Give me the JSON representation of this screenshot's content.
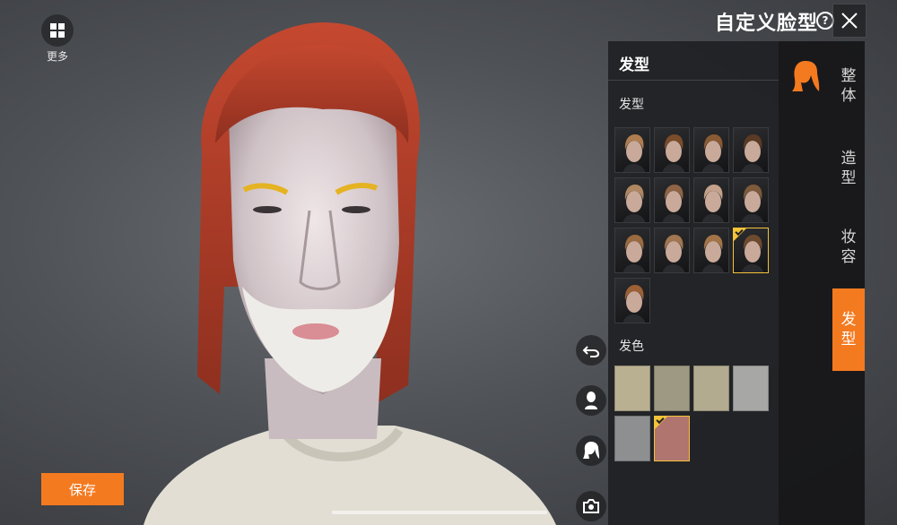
{
  "header": {
    "title": "自定义脸型",
    "help_glyph": "?"
  },
  "more_button": {
    "label": "更多",
    "icon": "grid-icon"
  },
  "panel": {
    "title": "发型",
    "hairstyle_section_label": "发型",
    "haircolor_section_label": "发色",
    "hairstyles": [
      {
        "tone": "#b07d4f"
      },
      {
        "tone": "#7a4c2a"
      },
      {
        "tone": "#8a5a33"
      },
      {
        "tone": "#5a3a25"
      },
      {
        "tone": "#b08760"
      },
      {
        "tone": "#8f6444"
      },
      {
        "tone": "#c3a18a"
      },
      {
        "tone": "#7d5a3c"
      },
      {
        "tone": "#9a6a40"
      },
      {
        "tone": "#a17650"
      },
      {
        "tone": "#a37448"
      },
      {
        "tone": "#6e4a2e"
      },
      {
        "tone": "#9b6034"
      }
    ],
    "selected_hairstyle_index": 11,
    "hair_colors": [
      "#b9b092",
      "#9d9982",
      "#b2ab8f",
      "#a7a7a5",
      "#8e8f91",
      "#b1756f"
    ],
    "selected_color_index": 5
  },
  "category_icon": {
    "name": "hair-category-icon",
    "color": "#f47a20"
  },
  "tabs": [
    {
      "label_top": "整",
      "label_bottom": "体",
      "active": false
    },
    {
      "label_top": "造",
      "label_bottom": "型",
      "active": false
    },
    {
      "label_top": "妆",
      "label_bottom": "容",
      "active": false
    },
    {
      "label_top": "发",
      "label_bottom": "型",
      "active": true
    }
  ],
  "side_buttons": [
    "undo-icon",
    "face-focus-icon",
    "hair-focus-icon",
    "camera-icon"
  ],
  "save_button": {
    "label": "保存"
  },
  "colors": {
    "accent": "#f47a20",
    "selected_border": "#f4c33a",
    "avatar_hair": "#c0442c"
  }
}
